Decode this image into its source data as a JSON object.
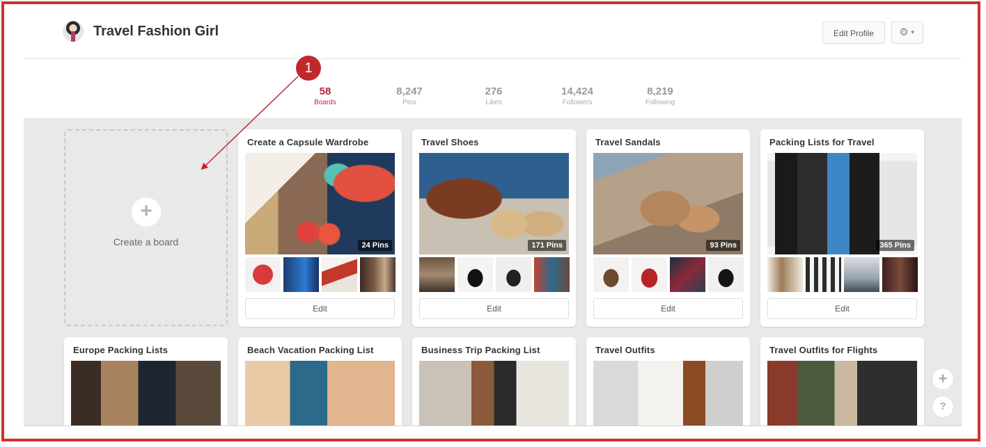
{
  "header": {
    "profile_name": "Travel Fashion Girl",
    "edit_profile_label": "Edit Profile",
    "settings_icon": "gear-icon"
  },
  "stats": [
    {
      "value": "58",
      "label": "Boards",
      "active": true
    },
    {
      "value": "8,247",
      "label": "Pins"
    },
    {
      "value": "276",
      "label": "Likes"
    },
    {
      "value": "14,424",
      "label": "Followers"
    },
    {
      "value": "8,219",
      "label": "Following"
    }
  ],
  "create_board": {
    "label": "Create a board",
    "icon": "plus-icon"
  },
  "boards": [
    {
      "title": "Create a Capsule Wardrobe",
      "pins": "24 Pins",
      "edit_label": "Edit"
    },
    {
      "title": "Travel Shoes",
      "pins": "171 Pins",
      "edit_label": "Edit"
    },
    {
      "title": "Travel Sandals",
      "pins": "93 Pins",
      "edit_label": "Edit"
    },
    {
      "title": "Packing Lists for Travel",
      "pins": "365 Pins",
      "edit_label": "Edit"
    },
    {
      "title": "Europe Packing Lists"
    },
    {
      "title": "Beach Vacation Packing List"
    },
    {
      "title": "Business Trip Packing List"
    },
    {
      "title": "Travel Outfits"
    },
    {
      "title": "Travel Outfits for Flights"
    }
  ],
  "side_buttons": {
    "add_icon": "plus-icon",
    "help_label": "?"
  },
  "annotation": {
    "step_number": "1"
  },
  "colors": {
    "accent": "#b3273c",
    "frame": "#d0312d",
    "callout": "#c0282c"
  }
}
